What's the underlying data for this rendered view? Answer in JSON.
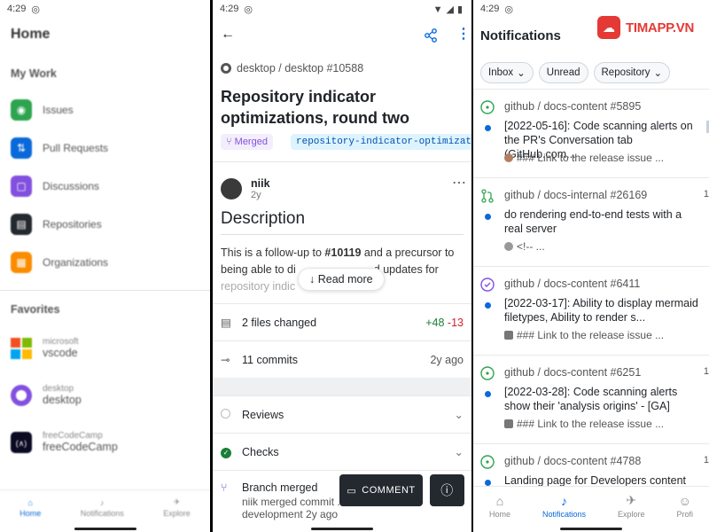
{
  "panel1": {
    "status_time": "4:29",
    "title": "Home",
    "my_work_heading": "My Work",
    "items": [
      {
        "label": "Issues",
        "color": "#2da44e"
      },
      {
        "label": "Pull Requests",
        "color": "#0969da"
      },
      {
        "label": "Discussions",
        "color": "#8250df"
      },
      {
        "label": "Repositories",
        "color": "#24292f"
      },
      {
        "label": "Organizations",
        "color": "#fb8c00"
      }
    ],
    "favorites_heading": "Favorites",
    "favorites": [
      {
        "owner": "microsoft",
        "name": "vscode"
      },
      {
        "owner": "desktop",
        "name": "desktop"
      },
      {
        "owner": "freeCodeCamp",
        "name": "freeCodeCamp"
      }
    ],
    "nav": [
      "Home",
      "Notifications",
      "Explore"
    ]
  },
  "panel2": {
    "status_time": "4:29",
    "repo_path": "desktop / desktop #10588",
    "pr_title": "Repository indicator optimizations, round two",
    "merged_label": "Merged",
    "branch": "repository-indicator-optimizati",
    "author": "niik",
    "age": "2y",
    "description_heading": "Description",
    "body_text": "This is a follow-up to #10119 and a precursor to being able to di... d updates for repository indic...",
    "body_line1_pre": "This is a follow-up to ",
    "body_link": "#10119",
    "body_line1_post": " and a precursor to",
    "body_line2": "being able to di",
    "body_line2_end": "d updates for",
    "body_line3": "repository indic",
    "read_more": "Read more",
    "files_changed": "2 files changed",
    "additions": "+48",
    "deletions": "-13",
    "commits": "11 commits",
    "commits_age": "2y ago",
    "reviews": "Reviews",
    "checks": "Checks",
    "branch_merged": "Branch merged",
    "merged_detail": "niik merged commit ... into",
    "merged_detail_2": "development 2y ago",
    "comment_btn": "COMMENT"
  },
  "panel3": {
    "status_time": "4:29",
    "title": "Notifications",
    "brand": "TIMAPP.VN",
    "filters": [
      "Inbox",
      "Unread",
      "Repository"
    ],
    "notifications": [
      {
        "source": "github / docs-content #5895",
        "title": "[2022-05-16]: Code scanning alerts on the PR's Conversation tab (GitHub.com...",
        "sub": "### Link to the release issue ...",
        "edge": "",
        "icon_color": "#2da44e"
      },
      {
        "source": "github / docs-internal #26169",
        "title": "do rendering end-to-end tests with a real server",
        "sub": "<!-- ...",
        "edge": "1",
        "icon_color": "#2da44e"
      },
      {
        "source": "github / docs-content #6411",
        "title": "[2022-03-17]: Ability to display mermaid filetypes, Ability to render s...",
        "sub": "### Link to the release issue ...",
        "edge": "",
        "icon_color": "#8250df"
      },
      {
        "source": "github / docs-content #6251",
        "title": "[2022-03-28]: Code scanning alerts show their 'analysis origins' - [GA]",
        "sub": "### Link to the release issue ...",
        "edge": "1",
        "icon_color": "#2da44e"
      },
      {
        "source": "github / docs-content #4788",
        "title": "Landing page for Developers content",
        "sub": "",
        "edge": "1",
        "icon_color": "#2da44e"
      }
    ],
    "nav": [
      "Home",
      "Notifications",
      "Explore",
      "Profi"
    ]
  }
}
